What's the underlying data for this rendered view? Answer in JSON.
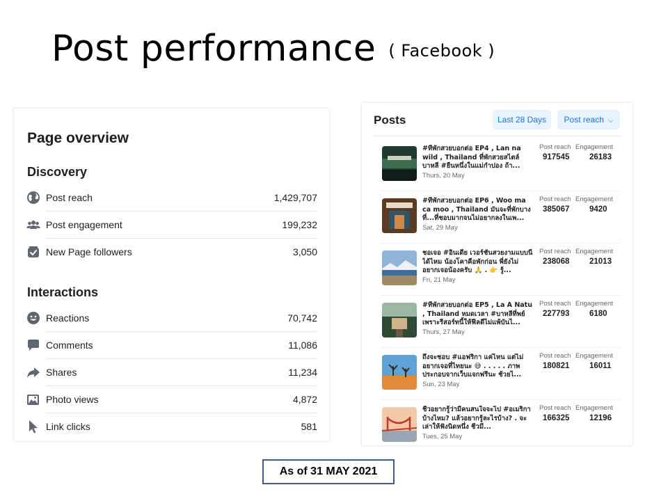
{
  "slide": {
    "title": "Post performance",
    "subtitle": "( Facebook )",
    "as_of": "As of  31 MAY 2021"
  },
  "overview": {
    "heading": "Page overview",
    "discovery_label": "Discovery",
    "interactions_label": "Interactions",
    "discovery": [
      {
        "label": "Post reach",
        "value": "1,429,707",
        "icon": "globe-icon"
      },
      {
        "label": "Post engagement",
        "value": "199,232",
        "icon": "people-icon"
      },
      {
        "label": "New Page followers",
        "value": "3,050",
        "icon": "follow-check-icon"
      }
    ],
    "interactions": [
      {
        "label": "Reactions",
        "value": "70,742",
        "icon": "smiley-icon"
      },
      {
        "label": "Comments",
        "value": "11,086",
        "icon": "comment-icon"
      },
      {
        "label": "Shares",
        "value": "11,234",
        "icon": "share-arrow-icon"
      },
      {
        "label": "Photo views",
        "value": "4,872",
        "icon": "photo-icon"
      },
      {
        "label": "Link clicks",
        "value": "581",
        "icon": "cursor-icon"
      }
    ]
  },
  "posts": {
    "title": "Posts",
    "range_button": "Last 28 Days",
    "metric_button": "Post reach",
    "col_reach": "Post reach",
    "col_engagement": "Engagement",
    "items": [
      {
        "text": "#ที่พักสวยบอกต่อ EP4 , Lan na wild , Thailand ที่พักสวยสไตล์บาหลี #ยืนหนึ่งในแม่กำปอง ถ้า...",
        "date": "Thurs, 20 May",
        "reach": "917545",
        "engagement": "26183"
      },
      {
        "text": "#ที่พักสวยบอกต่อ EP6 , Woo ma ca moo , Thailand มันจะที่พักบางที่...ที่ชอบมากจนไม่อยากลงในเพ...",
        "date": "Sat, 29 May",
        "reach": "385067",
        "engagement": "9420"
      },
      {
        "text": "ชอเจอ #อินเดีย เวอร์ชั่นสวยงามแบบนี้ได้ไหม น้องโคาคือพักก่อน พี่ยังไม่อยากเจอน้องครับ 🙏 . 👉 รู้...",
        "date": "Fri, 21 May",
        "reach": "238068",
        "engagement": "21013"
      },
      {
        "text": "#ที่พักสวยบอกต่อ EP5 , La A Natu , Thailand หมดเวลา #บาหลีที่พย์ เพราะรีสอร์ทนี้ให้ฟีลดีไม่แพ้บันไ...",
        "date": "Thurs, 27 May",
        "reach": "227793",
        "engagement": "6180"
      },
      {
        "text": "ถึงจะชอบ #แอฟริกา แค่ไหน แต่ไม่อยากเจอที่ไทยนะ 😅 . . . . . ภาพประกอบจากเว็บแจกฟรีนะ ช้วยไ...",
        "date": "Sun, 23 May",
        "reach": "180821",
        "engagement": "16011"
      },
      {
        "text": "ชีวอยากรู้ว่ามีคนสนใจจะไป #อเมริกา บ้างไหม? แล้วอยากรู้ละไรบ้าง? . จะเล่าให้ฟังนิดหนึ่ง ชีวมี...",
        "date": "Tues, 25 May",
        "reach": "166325",
        "engagement": "12196"
      }
    ]
  }
}
